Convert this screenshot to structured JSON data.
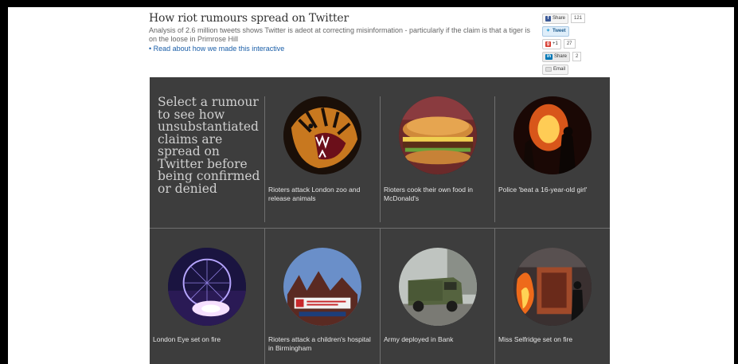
{
  "article": {
    "title": "How riot rumours spread on Twitter",
    "subtitle": "Analysis of 2.6 million tweets shows Twitter is adeot at correcting misinformation - particularly if the claim is that a tiger is on the loose in Primrose Hill",
    "read_link": "• Read about how we made this interactive"
  },
  "share": {
    "facebook_label": "Share",
    "facebook_count": "121",
    "tweet_label": "Tweet",
    "gplus_label": "+1",
    "gplus_count": "27",
    "linkedin_label": "Share",
    "linkedin_count": "2",
    "email_label": "Email"
  },
  "panel": {
    "intro": "Select a rumour to see how unsubstantiated claims are spread on Twitter before being confirmed or denied",
    "rumours": [
      {
        "label": "Rioters attack London zoo and release animals",
        "icon": "tiger-photo"
      },
      {
        "label": "Rioters cook their own food in McDonald's",
        "icon": "burger-photo"
      },
      {
        "label": "Police 'beat a 16-year-old girl'",
        "icon": "riot-fire-photo"
      },
      {
        "label": "London Eye set on fire",
        "icon": "london-eye-photo"
      },
      {
        "label": "Rioters attack a children's hospital in Birmingham",
        "icon": "hospital-photo"
      },
      {
        "label": "Army deployed in Bank",
        "icon": "army-truck-photo"
      },
      {
        "label": "Miss Selfridge set on fire",
        "icon": "burning-shop-photo"
      }
    ]
  },
  "colors": {
    "panel_bg": "#3d3d3d",
    "link": "#1a5ea8",
    "intro_text": "#cfcfcf"
  }
}
